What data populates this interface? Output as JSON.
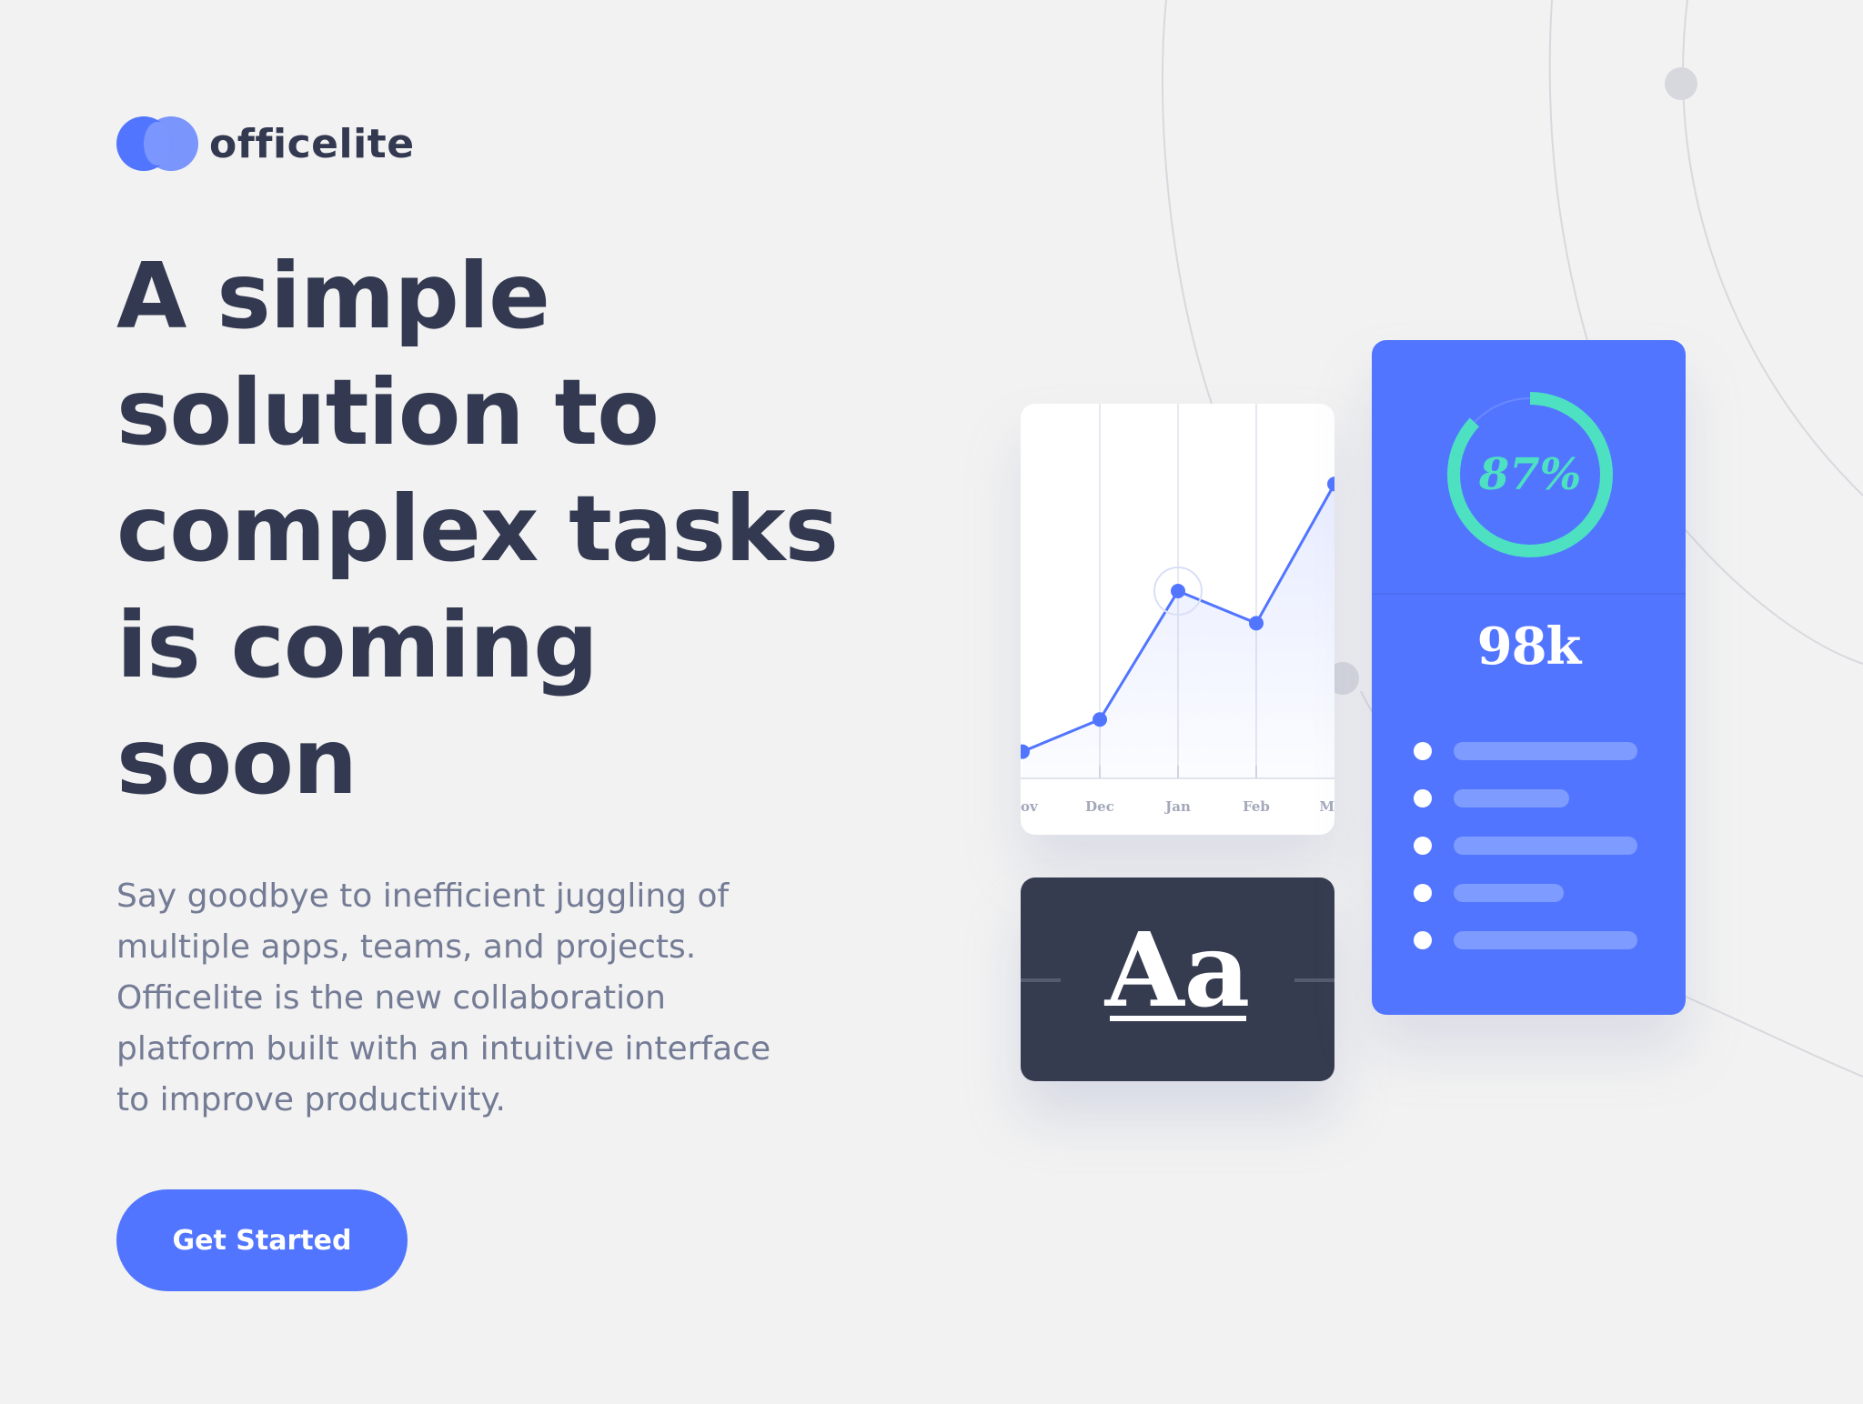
{
  "brand": {
    "name": "officelite",
    "color": "#5175ff"
  },
  "hero": {
    "headline": "A simple solution to complex tasks is coming soon",
    "description": "Say goodbye to inefficient juggling of multiple apps, teams, and projects. Officelite is the new collaboration platform built with an intuitive interface to improve productivity.",
    "cta_label": "Get Started"
  },
  "preview": {
    "type_sample": "Aa",
    "progress_label": "87%",
    "progress_value": 0.87,
    "stat": "98k",
    "list_fills": [
      1.0,
      0.63,
      1.0,
      0.6,
      1.0
    ]
  },
  "chart_data": {
    "type": "line",
    "categories": [
      "Nov",
      "Dec",
      "Jan",
      "Feb",
      "Mar"
    ],
    "visible_tick_labels": [
      "ov",
      "Dec",
      "Jan",
      "Feb",
      "M"
    ],
    "values": [
      10,
      22,
      70,
      58,
      110
    ],
    "ylim": [
      0,
      140
    ],
    "highlight_category": "Jan",
    "grid": "vertical",
    "colors": {
      "line": "#5175ff",
      "fill": "#eef1fc"
    }
  }
}
